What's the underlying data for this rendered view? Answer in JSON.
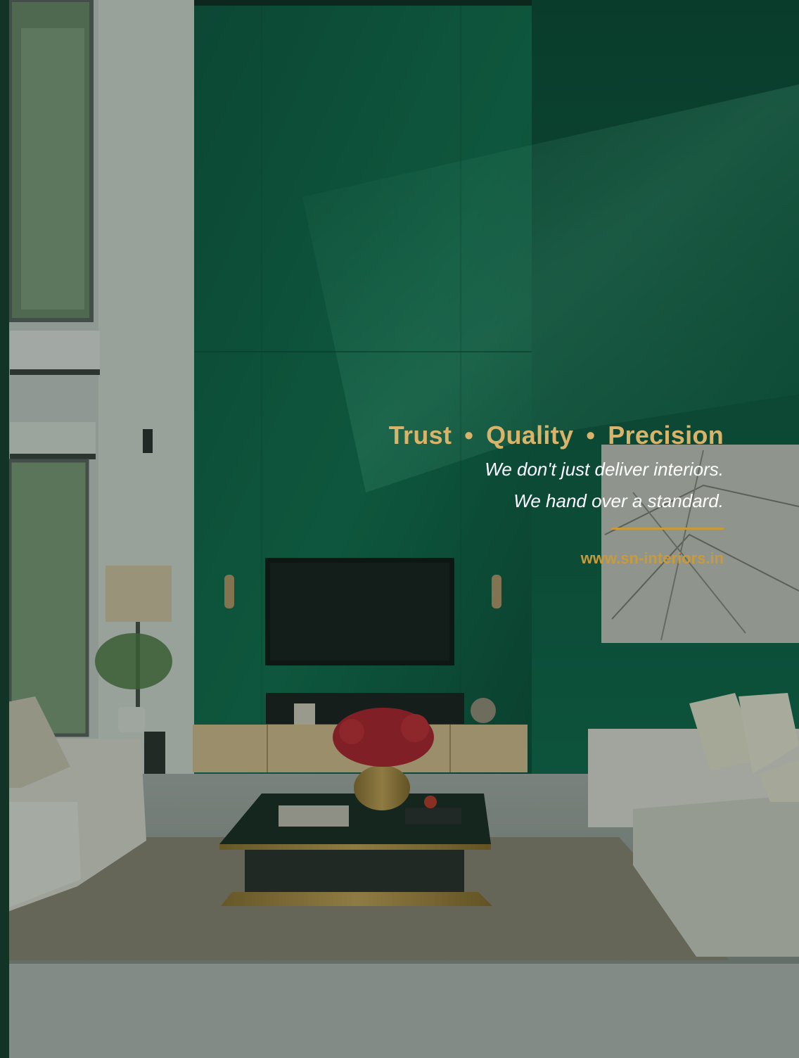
{
  "brand": {
    "tagline_words": [
      "Trust",
      "Quality",
      "Precision"
    ],
    "separator": "•",
    "statement_lines": [
      "We don't just deliver interiors.",
      "We hand over a standard."
    ],
    "website": "www.sn-interiors.in"
  },
  "colors": {
    "gold": "#d9b36a",
    "accent_rule": "#c99a3b",
    "wall_green": "#0f6b4e",
    "edge_dark": "#123427"
  }
}
